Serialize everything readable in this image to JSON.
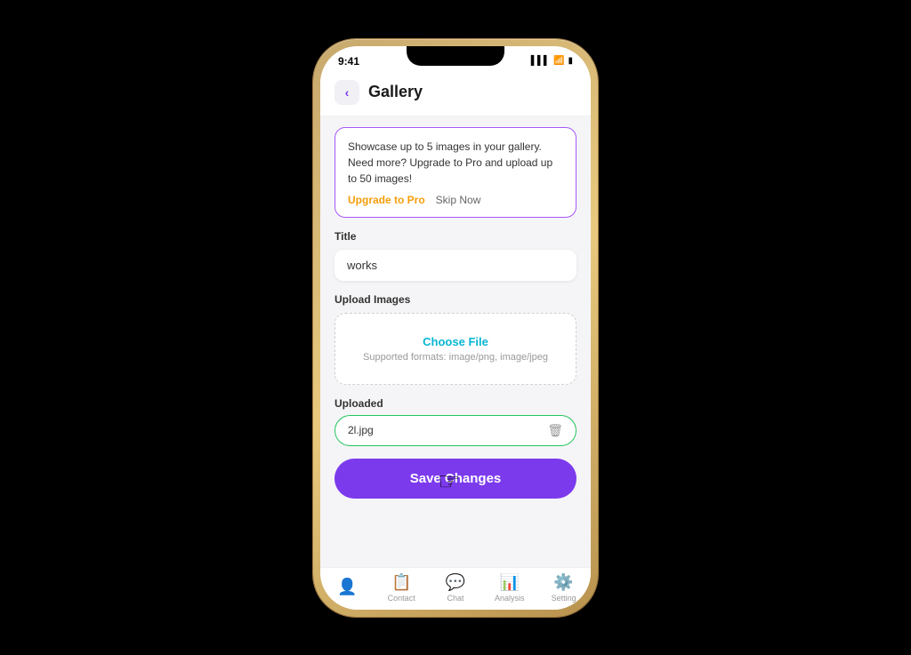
{
  "statusBar": {
    "time": "9:41",
    "signal": "▌▌▌",
    "wifi": "WiFi",
    "battery": "🔋"
  },
  "header": {
    "backLabel": "‹",
    "title": "Gallery"
  },
  "promoBanner": {
    "text": "Showcase up to 5 images in your gallery. Need more? Upgrade to Pro and upload up to 50 images!",
    "upgradeLabel": "Upgrade to Pro",
    "skipLabel": "Skip Now"
  },
  "form": {
    "titleLabel": "Title",
    "titleValue": "works",
    "titlePlaceholder": "works",
    "uploadLabel": "Upload Images",
    "chooseFileLabel": "Choose File",
    "supportedFormats": "Supported formats: image/png, image/jpeg",
    "uploadedLabel": "Uploaded",
    "uploadedFile": {
      "name": "2l.jpg",
      "deleteIcon": "🗑"
    }
  },
  "saveButton": {
    "label": "Save Changes"
  },
  "bottomNav": {
    "items": [
      {
        "id": "profile",
        "icon": "👤",
        "label": "",
        "active": true
      },
      {
        "id": "contact",
        "icon": "📋",
        "label": "Contact",
        "active": false
      },
      {
        "id": "chat",
        "icon": "💬",
        "label": "Chat",
        "active": false
      },
      {
        "id": "analysis",
        "icon": "📊",
        "label": "Analysis",
        "active": false
      },
      {
        "id": "setting",
        "icon": "⚙️",
        "label": "Setting",
        "active": false
      }
    ]
  }
}
